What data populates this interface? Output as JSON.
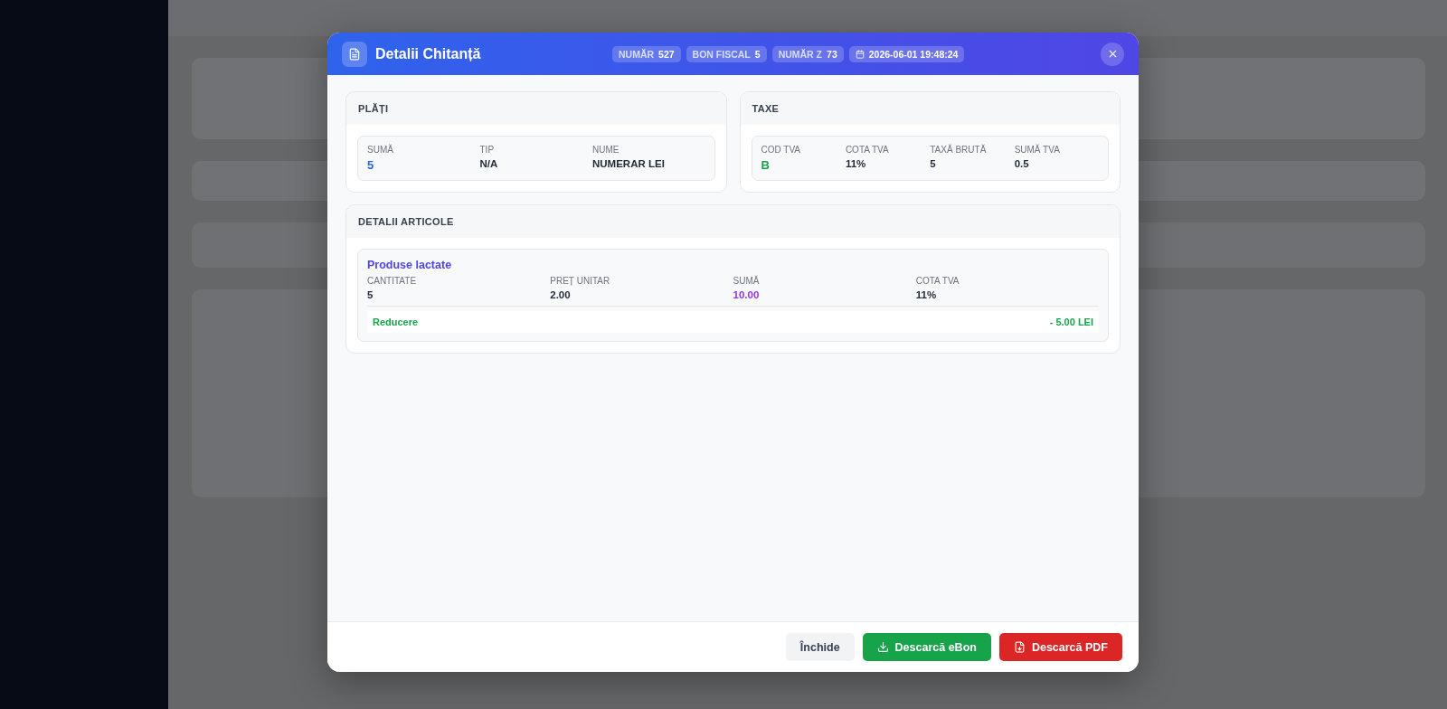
{
  "dialog": {
    "title": "Detalii Chitanță",
    "badges": [
      {
        "kind": "field",
        "label": "NUMĂR",
        "value": "527"
      },
      {
        "kind": "field",
        "label": "BON FISCAL",
        "value": "5"
      },
      {
        "kind": "field",
        "label": "NUMĂR Z",
        "value": "73"
      },
      {
        "kind": "date",
        "value": "2026-06-01 19:48:24"
      }
    ]
  },
  "payments": {
    "title": "PLĂȚI",
    "fields": [
      {
        "label": "SUMĂ",
        "value": "5",
        "kind": "amount"
      },
      {
        "label": "TIP",
        "value": "N/A",
        "kind": "plain"
      },
      {
        "label": "NUME",
        "value": "NUMERAR LEI",
        "kind": "plain"
      }
    ]
  },
  "taxes": {
    "title": "TAXE",
    "fields": [
      {
        "label": "COD TVA",
        "value": "B",
        "kind": "code"
      },
      {
        "label": "COTA TVA",
        "value": "11%",
        "kind": "plain"
      },
      {
        "label": "TAXĂ BRUTĂ",
        "value": "5",
        "kind": "plain"
      },
      {
        "label": "SUMĂ TVA",
        "value": "0.5",
        "kind": "plain"
      }
    ]
  },
  "articles": {
    "title": "DETALII ARTICOLE",
    "items": [
      {
        "name": "Produse lactate",
        "fields": [
          {
            "label": "CANTITATE",
            "value": "5",
            "kind": "plain"
          },
          {
            "label": "PREȚ UNITAR",
            "value": "2.00",
            "kind": "plain"
          },
          {
            "label": "SUMĂ",
            "value": "10.00",
            "kind": "total"
          },
          {
            "label": "COTA TVA",
            "value": "11%",
            "kind": "plain"
          }
        ],
        "discount": {
          "label": "Reducere",
          "value": "- 5.00 LEI"
        }
      }
    ]
  },
  "buttons": [
    {
      "kind": "close",
      "label": "Închide"
    },
    {
      "kind": "ebon",
      "label": "Descarcă eBon"
    },
    {
      "kind": "pdf",
      "label": "Descarcă PDF"
    }
  ]
}
